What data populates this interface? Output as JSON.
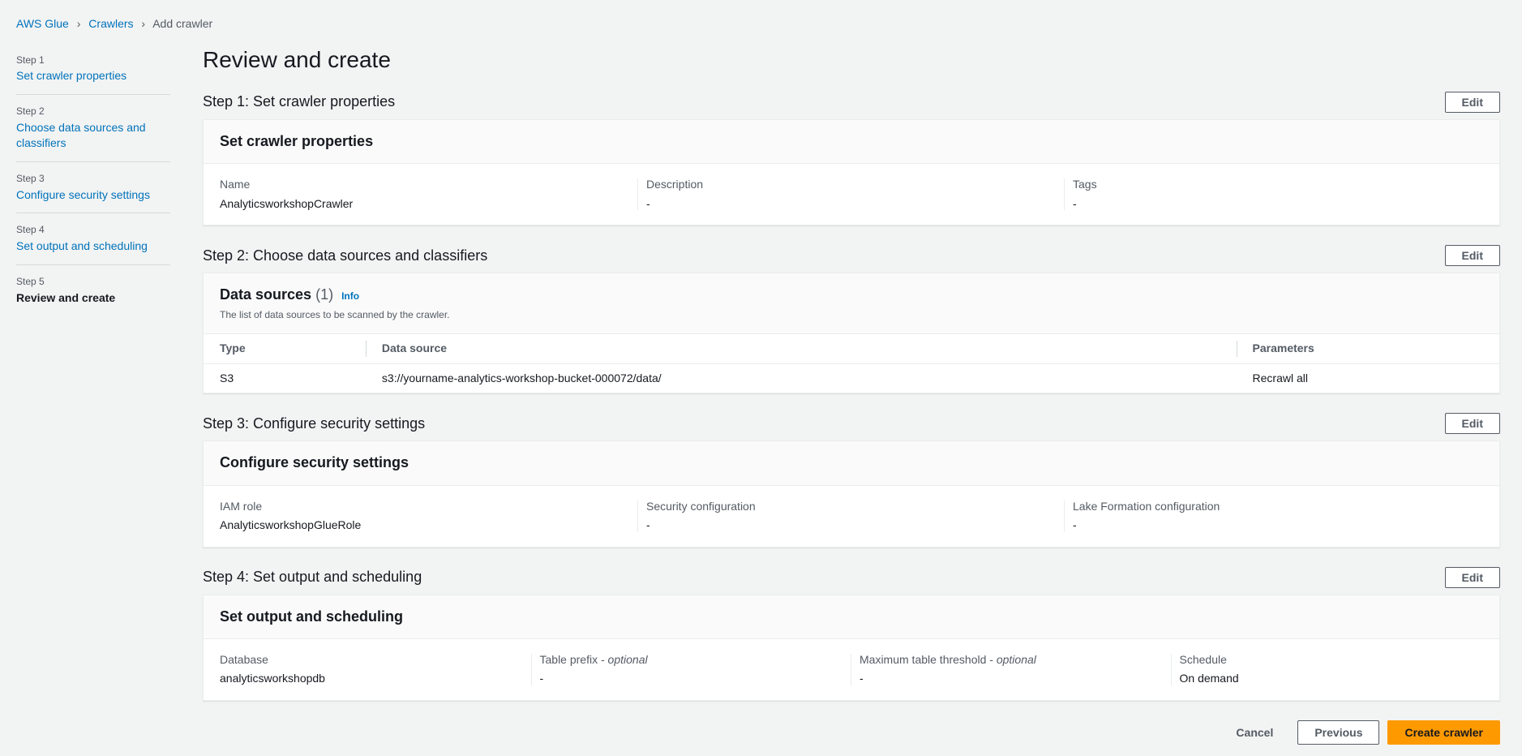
{
  "breadcrumb": {
    "items": [
      {
        "label": "AWS Glue",
        "link": true
      },
      {
        "label": "Crawlers",
        "link": true
      },
      {
        "label": "Add crawler",
        "link": false
      }
    ]
  },
  "sidebar": {
    "steps": [
      {
        "number": "Step 1",
        "title": "Set crawler properties",
        "active": false
      },
      {
        "number": "Step 2",
        "title": "Choose data sources and classifiers",
        "active": false
      },
      {
        "number": "Step 3",
        "title": "Configure security settings",
        "active": false
      },
      {
        "number": "Step 4",
        "title": "Set output and scheduling",
        "active": false
      },
      {
        "number": "Step 5",
        "title": "Review and create",
        "active": true
      }
    ]
  },
  "page": {
    "title": "Review and create"
  },
  "step1": {
    "heading": "Step 1: Set crawler properties",
    "edit": "Edit",
    "panel_title": "Set crawler properties",
    "name_label": "Name",
    "name_value": "AnalyticsworkshopCrawler",
    "description_label": "Description",
    "description_value": "-",
    "tags_label": "Tags",
    "tags_value": "-"
  },
  "step2": {
    "heading": "Step 2: Choose data sources and classifiers",
    "edit": "Edit",
    "panel_title": "Data sources",
    "count": "(1)",
    "info": "Info",
    "subtitle": "The list of data sources to be scanned by the crawler.",
    "columns": {
      "type": "Type",
      "source": "Data source",
      "params": "Parameters"
    },
    "rows": [
      {
        "type": "S3",
        "source": "s3://yourname-analytics-workshop-bucket-000072/data/",
        "params": "Recrawl all"
      }
    ]
  },
  "step3": {
    "heading": "Step 3: Configure security settings",
    "edit": "Edit",
    "panel_title": "Configure security settings",
    "iam_label": "IAM role",
    "iam_value": "AnalyticsworkshopGlueRole",
    "sec_label": "Security configuration",
    "sec_value": "-",
    "lake_label": "Lake Formation configuration",
    "lake_value": "-"
  },
  "step4": {
    "heading": "Step 4: Set output and scheduling",
    "edit": "Edit",
    "panel_title": "Set output and scheduling",
    "db_label": "Database",
    "db_value": "analyticsworkshopdb",
    "prefix_label": "Table prefix - ",
    "prefix_optional": "optional",
    "prefix_value": "-",
    "threshold_label": "Maximum table threshold - ",
    "threshold_optional": "optional",
    "threshold_value": "-",
    "schedule_label": "Schedule",
    "schedule_value": "On demand"
  },
  "footer": {
    "cancel": "Cancel",
    "previous": "Previous",
    "create": "Create crawler"
  }
}
